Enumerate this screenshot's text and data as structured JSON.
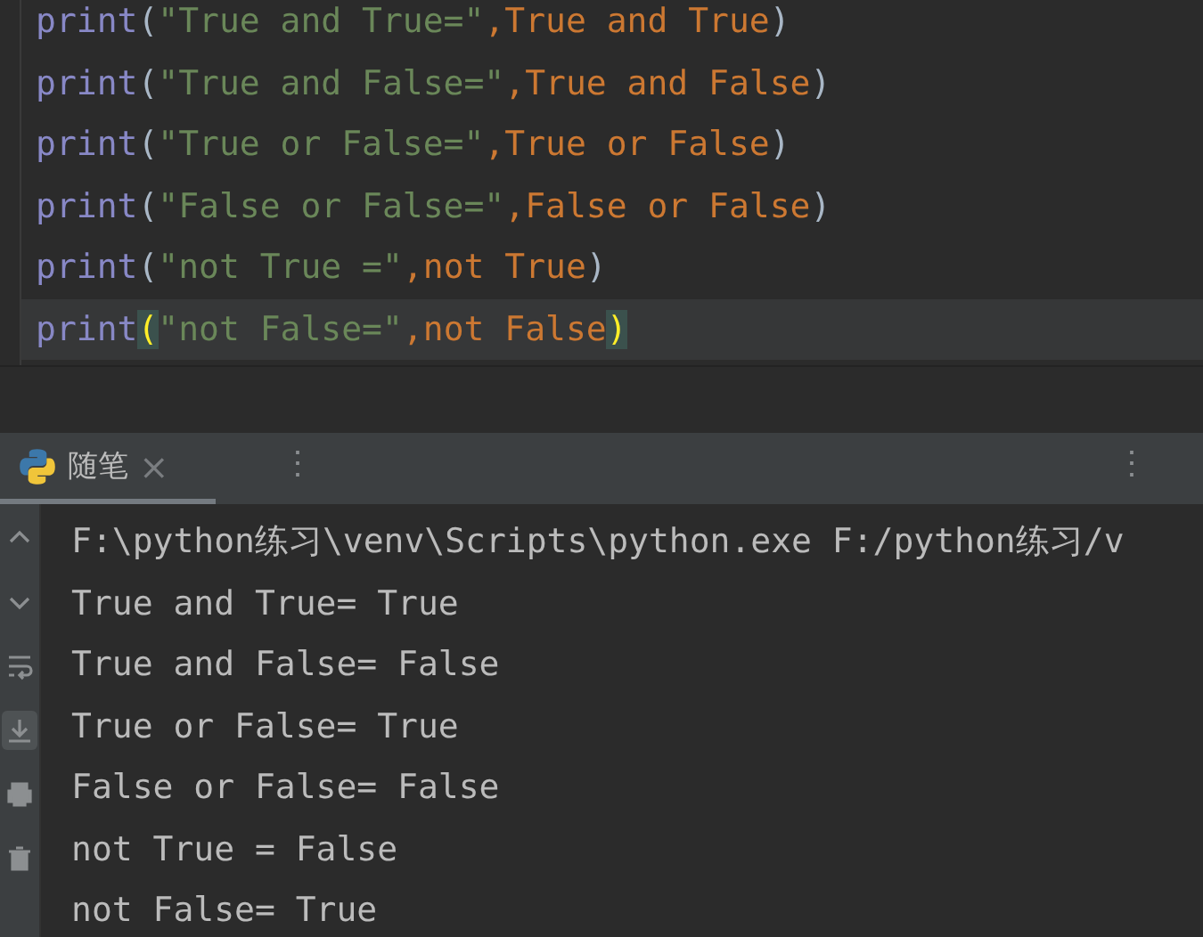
{
  "editor": {
    "lines": [
      {
        "current": false,
        "tokens": [
          {
            "kind": "name",
            "text": "print"
          },
          {
            "kind": "paren",
            "text": "(",
            "matched": false
          },
          {
            "kind": "string",
            "text": "\"True and True=\""
          },
          {
            "kind": "punct",
            "text": ","
          },
          {
            "kind": "code",
            "text": "True and True"
          },
          {
            "kind": "paren",
            "text": ")",
            "matched": false
          }
        ]
      },
      {
        "current": false,
        "tokens": [
          {
            "kind": "name",
            "text": "print"
          },
          {
            "kind": "paren",
            "text": "(",
            "matched": false
          },
          {
            "kind": "string",
            "text": "\"True and False=\""
          },
          {
            "kind": "punct",
            "text": ","
          },
          {
            "kind": "code",
            "text": "True and False"
          },
          {
            "kind": "paren",
            "text": ")",
            "matched": false
          }
        ]
      },
      {
        "current": false,
        "tokens": [
          {
            "kind": "name",
            "text": "print"
          },
          {
            "kind": "paren",
            "text": "(",
            "matched": false
          },
          {
            "kind": "string",
            "text": "\"True or False=\""
          },
          {
            "kind": "punct",
            "text": ","
          },
          {
            "kind": "code",
            "text": "True or False"
          },
          {
            "kind": "paren",
            "text": ")",
            "matched": false
          }
        ]
      },
      {
        "current": false,
        "tokens": [
          {
            "kind": "name",
            "text": "print"
          },
          {
            "kind": "paren",
            "text": "(",
            "matched": false
          },
          {
            "kind": "string",
            "text": "\"False or False=\""
          },
          {
            "kind": "punct",
            "text": ","
          },
          {
            "kind": "code",
            "text": "False or False"
          },
          {
            "kind": "paren",
            "text": ")",
            "matched": false
          }
        ]
      },
      {
        "current": false,
        "tokens": [
          {
            "kind": "name",
            "text": "print"
          },
          {
            "kind": "paren",
            "text": "(",
            "matched": false
          },
          {
            "kind": "string",
            "text": "\"not True =\""
          },
          {
            "kind": "punct",
            "text": ","
          },
          {
            "kind": "code",
            "text": "not True"
          },
          {
            "kind": "paren",
            "text": ")",
            "matched": false
          }
        ]
      },
      {
        "current": true,
        "tokens": [
          {
            "kind": "name",
            "text": "print"
          },
          {
            "kind": "paren",
            "text": "(",
            "matched": true
          },
          {
            "kind": "string",
            "text": "\"not False=\""
          },
          {
            "kind": "punct",
            "text": ","
          },
          {
            "kind": "code",
            "text": "not False"
          },
          {
            "kind": "paren",
            "text": ")",
            "matched": true
          }
        ]
      }
    ]
  },
  "run_panel": {
    "tab": {
      "label": "随笔",
      "close": "×",
      "selected": true
    },
    "menu_left": "⋮",
    "menu_right": "⋮",
    "toolbar": [
      {
        "kind": "up",
        "selected": false
      },
      {
        "kind": "down",
        "selected": false
      },
      {
        "kind": "wrap",
        "selected": false
      },
      {
        "kind": "scroll-end",
        "selected": true
      },
      {
        "kind": "print",
        "selected": false
      },
      {
        "kind": "trash",
        "selected": false
      }
    ],
    "output": [
      "F:\\python练习\\venv\\Scripts\\python.exe F:/python练习/v",
      "True and True= True",
      "True and False= False",
      "True or False= True",
      "False or False= False",
      "not True = False",
      "not False= True"
    ]
  }
}
